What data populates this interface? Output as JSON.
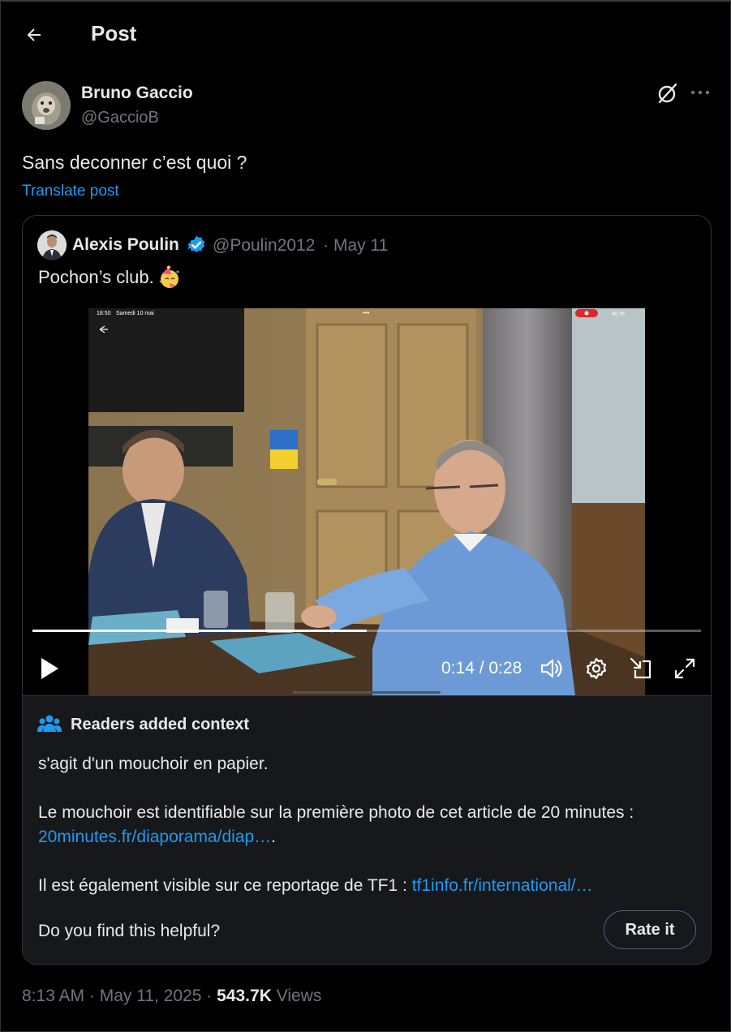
{
  "header": {
    "title": "Post",
    "back_icon": "arrow-left-icon"
  },
  "post": {
    "author_name": "Bruno Gaccio",
    "author_handle": "@GaccioB",
    "text": "Sans deconner c’est quoi ?",
    "translate_label": "Translate post",
    "icons": [
      "grok-icon",
      "more-icon"
    ]
  },
  "quote": {
    "author_name": "Alexis Poulin",
    "author_handle": "@Poulin2012",
    "separator": "·",
    "date": "May 11",
    "text": "Pochon’s club.",
    "emoji_icon": "party-face-icon",
    "verified_color": "#1d9bf0"
  },
  "video": {
    "status_time": "18:50",
    "status_date": "Samedi 10 mai",
    "battery": "40 %",
    "time_display": "0:14 / 0:28",
    "progress": 0.5,
    "controls": [
      "play-icon",
      "volume-icon",
      "settings-icon",
      "pip-icon",
      "fullscreen-icon"
    ]
  },
  "note": {
    "title": "Readers added context",
    "line1": "s'agit d'un mouchoir en papier.",
    "line2": "Le mouchoir est identifiable sur la première photo de cet article de 20 minutes :",
    "link1": "20minutes.fr/diaporama/diap…",
    "link1_suffix": ".",
    "line3": "Il est également visible sur ce reportage de TF1 :",
    "link2": "tf1info.fr/international/…",
    "question": "Do you find this helpful?",
    "rate_label": "Rate it"
  },
  "meta": {
    "time": "8:13 AM",
    "date": "May 11, 2025",
    "sep": "·",
    "views_count": "543.7K",
    "views_label": "Views"
  },
  "colors": {
    "accent": "#1d9bf0",
    "background": "#000000",
    "note_bg": "#16181c"
  }
}
